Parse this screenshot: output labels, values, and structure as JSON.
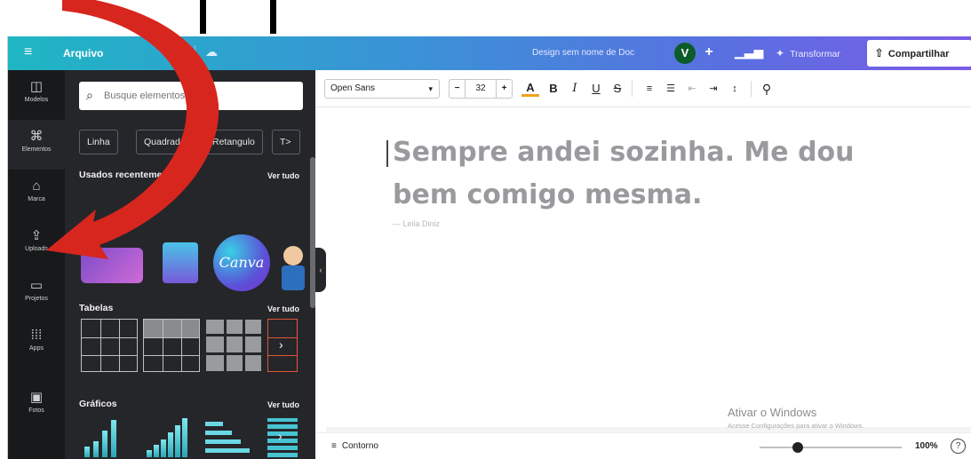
{
  "header": {
    "menu_icon": "hamburger-icon",
    "file_label": "Arquivo",
    "undo_icon": "undo-icon",
    "cloud_icon": "cloud-saved-icon",
    "doc_name": "Design sem nome de Doc",
    "avatar_initial": "V",
    "add_label": "+",
    "stats_icon": "analytics-icon",
    "transform_label": "Transformar",
    "share_label": "Compartilhar",
    "accent_gradient": [
      "#1fb6c4",
      "#3d8fd8",
      "#5a6fe0",
      "#7b5ce8"
    ]
  },
  "rail": {
    "items": [
      {
        "label": "Modelos",
        "icon": "layout-icon"
      },
      {
        "label": "Elementos",
        "icon": "shapes-icon",
        "active": true
      },
      {
        "label": "Marca",
        "icon": "brand-icon"
      },
      {
        "label": "Uploads",
        "icon": "upload-icon"
      },
      {
        "label": "Projetos",
        "icon": "folder-icon"
      },
      {
        "label": "Apps",
        "icon": "apps-grid-icon"
      },
      {
        "label": "Fotos",
        "icon": "photo-icon"
      }
    ]
  },
  "panel": {
    "search_placeholder": "Busque elementos",
    "chips": [
      "Linha",
      "Quadrado",
      "Retangulo",
      "T>"
    ],
    "recent_title": "Usados recentemente",
    "tables_title": "Tabelas",
    "graphs_title": "Gráficos",
    "see_all": "Ver tudo",
    "canva_logo_text": "Canva"
  },
  "toolbar": {
    "font": "Open Sans",
    "size": "32",
    "minus": "−",
    "plus": "+"
  },
  "canvas": {
    "quote_line1": "Sempre andei sozinha. Me dou",
    "quote_line2": "bem comigo mesma.",
    "author": "— Leila Diniz"
  },
  "watermark": {
    "line1": "Ativar o Windows",
    "line2": "Acesse Configurações para ativar o Windows."
  },
  "footer": {
    "outline_label": "Contorno",
    "zoom": "100%",
    "help": "?"
  },
  "overlay": {
    "arrow_color": "#d7261e"
  }
}
